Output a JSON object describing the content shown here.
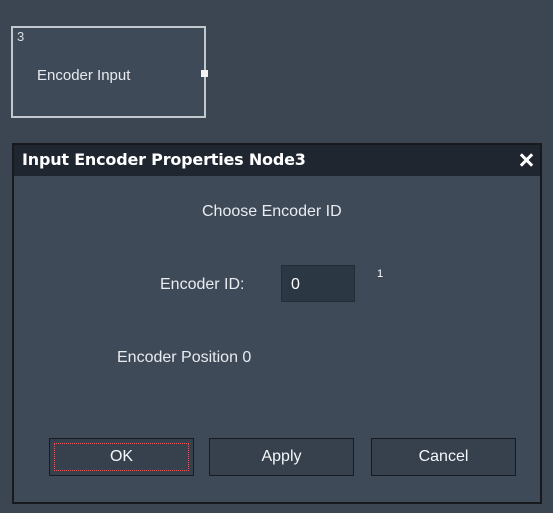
{
  "node": {
    "number": "3",
    "label": "Encoder Input"
  },
  "dialog": {
    "title": "Input Encoder Properties Node3",
    "heading": "Choose Encoder ID",
    "encoder_id_label": "Encoder ID:",
    "encoder_id_value": "0",
    "superscript_value": "1",
    "encoder_position_text": "Encoder Position 0",
    "buttons": {
      "ok": "OK",
      "apply": "Apply",
      "cancel": "Cancel"
    }
  },
  "icons": {
    "close": "close-icon"
  },
  "colors": {
    "canvas_background": "#3c4653",
    "dialog_title_background": "#1f2630",
    "button_background": "#36414d",
    "focus_ring": "#ee5858"
  }
}
